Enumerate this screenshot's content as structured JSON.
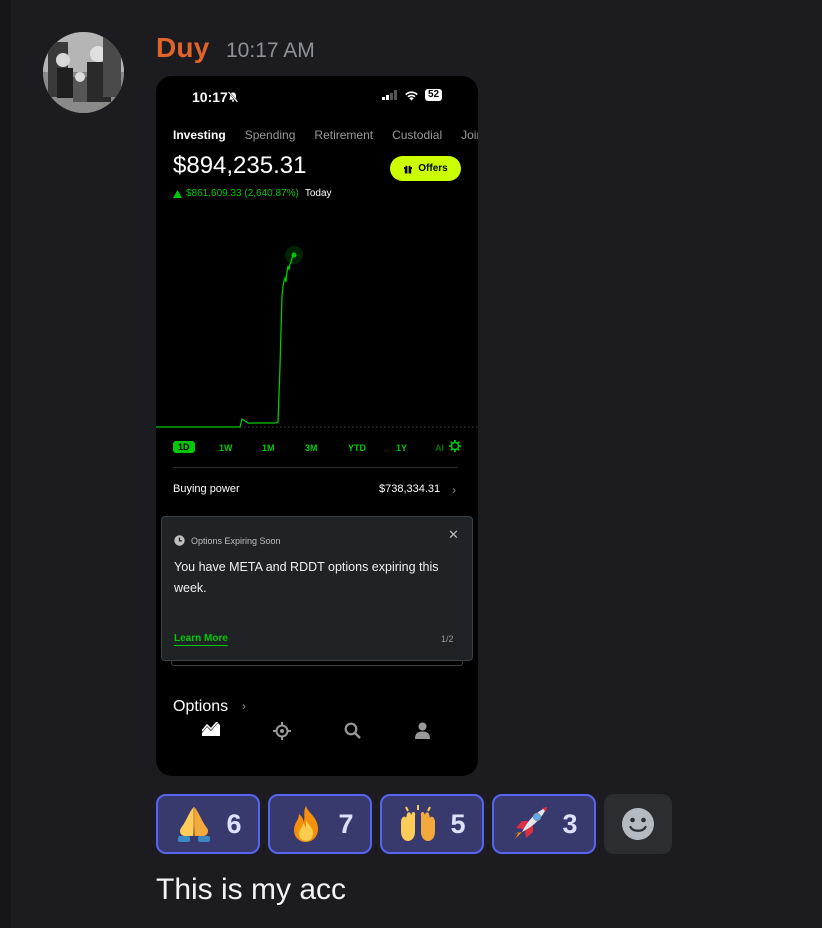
{
  "message": {
    "author": "Duy",
    "time": "10:17 AM",
    "text": "This is my acc",
    "author_color": "#e0632a"
  },
  "screenshot": {
    "status_time": "10:17",
    "battery": "52",
    "tabs": [
      "Investing",
      "Spending",
      "Retirement",
      "Custodial",
      "Joint"
    ],
    "balance": "$894,235.31",
    "offers_label": "Offers",
    "gain": "$861,609.33 (2,640.87%)",
    "gain_period": "Today",
    "ranges": [
      "1D",
      "1W",
      "1M",
      "3M",
      "YTD",
      "1Y",
      "Al"
    ],
    "buying_power_label": "Buying power",
    "buying_power_value": "$738,334.31",
    "popup": {
      "title": "Options Expiring Soon",
      "body": "You have META and RDDT options expiring this week.",
      "link": "Learn More",
      "page": "1/2"
    },
    "options_label": "Options",
    "accent": "#00c805",
    "offers_color": "#ccff00"
  },
  "reactions": [
    {
      "emoji": "folded-hands",
      "count": "6"
    },
    {
      "emoji": "fire",
      "count": "7"
    },
    {
      "emoji": "raising-hands",
      "count": "5"
    },
    {
      "emoji": "rocket",
      "count": "3"
    }
  ],
  "accent_reaction": "#5865f2"
}
